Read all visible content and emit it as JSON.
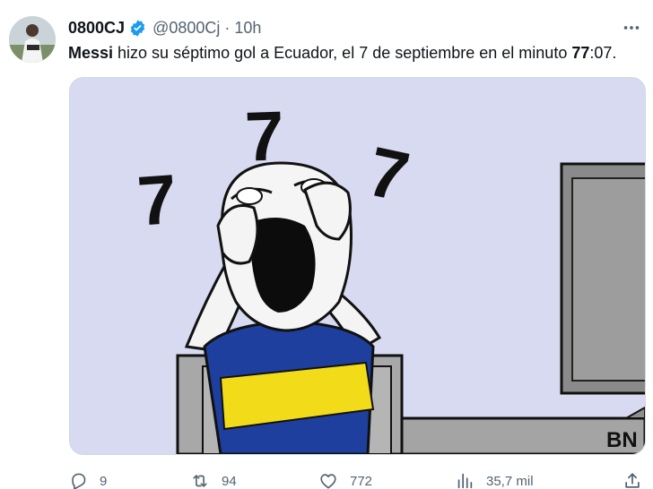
{
  "author": {
    "display_name": "0800CJ",
    "handle": "@0800Cj",
    "separator": "·",
    "time": "10h",
    "avatar_icon": "avatar-photo",
    "verified_color": "#1d9bf0"
  },
  "tweet": {
    "text_parts": [
      "Messi",
      " hizo su séptimo gol a Ecuador, el 7 de septiembre en el minuto ",
      "77",
      ":07."
    ]
  },
  "media": {
    "numbers": [
      "7",
      "7",
      "7"
    ],
    "signature": "BN",
    "background_color": "#d7daf0",
    "jersey_colors": [
      "#1f3f9e",
      "#f2dc1a"
    ]
  },
  "actions": {
    "reply_count": "9",
    "retweet_count": "94",
    "like_count": "772",
    "views_count": "35,7 mil"
  },
  "colors": {
    "secondary_text": "#536471",
    "primary_text": "#0f1419"
  }
}
